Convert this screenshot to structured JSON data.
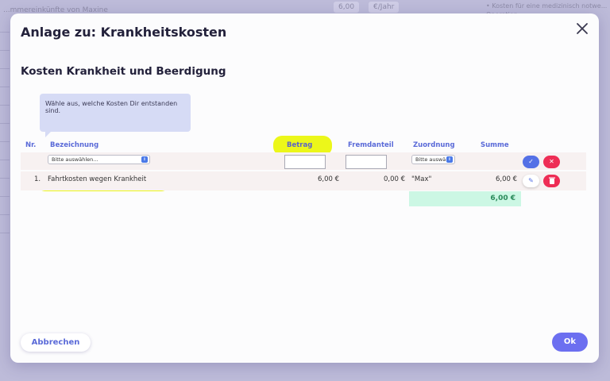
{
  "background": {
    "left_text": "...mmereinkünfte von Maxine",
    "mid_values": [
      "6,00",
      "€/Jahr"
    ],
    "right_text": "• Kosten für eine medizinisch notwe... Operation"
  },
  "modal": {
    "title": "Anlage zu: Krankheitskosten",
    "section_title": "Kosten Krankheit und Beerdigung",
    "tooltip": "Wähle aus, welche Kosten Dir entstanden sind.",
    "table": {
      "headers": {
        "nr": "Nr.",
        "bezeichnung": "Bezeichnung",
        "betrag": "Betrag",
        "fremdanteil": "Fremdanteil",
        "zuordnung": "Zuordnung",
        "summe": "Summe"
      },
      "input_row": {
        "bezeichnung_select": "Bitte auswählen...",
        "zuordnung_select": "Bitte auswä"
      },
      "rows": [
        {
          "nr": "1.",
          "bezeichnung": "Fahrtkosten wegen Krankheit",
          "betrag": "6,00 €",
          "fremdanteil": "0,00 €",
          "zuordnung": "\"Max\"",
          "summe": "6,00 €"
        }
      ],
      "total": "6,00 €"
    },
    "cancel_label": "Abbrechen",
    "ok_label": "Ok"
  },
  "colors": {
    "accent": "#5a6ad8",
    "highlight": "#ecf71a",
    "confirm": "#5470e6",
    "danger": "#ee2d55",
    "total_bg": "#ccf7e4"
  }
}
